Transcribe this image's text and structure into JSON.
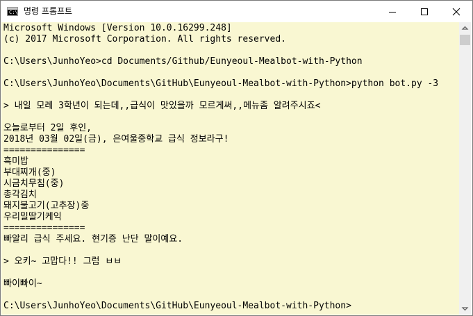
{
  "window": {
    "title": "명령 프롬프트",
    "icon": "cmd-icon",
    "icon_text": "C:\\"
  },
  "controls": {
    "minimize_icon": "minimize-icon",
    "maximize_icon": "maximize-icon",
    "close_icon": "close-icon"
  },
  "console": {
    "background": "#f9f7d2",
    "text_color": "#000000",
    "lines": [
      "Microsoft Windows [Version 10.0.16299.248]",
      "(c) 2017 Microsoft Corporation. All rights reserved.",
      "",
      "C:\\Users\\JunhoYeo>cd Documents/Github/Eunyeoul-Mealbot-with-Python",
      "",
      "C:\\Users\\JunhoYeo\\Documents\\GitHub\\Eunyeoul-Mealbot-with-Python>python bot.py -3",
      "",
      "> 내일 모레 3학년이 되는데,,급식이 맛있을까 모르게써,,메뉴좀 알려주시죠<",
      "",
      "오늘로부터 2일 후인,",
      "2018년 03월 02일(금), 은여울중학교 급식 정보라구!",
      "===============",
      "흑미밥",
      "부대찌개(중)",
      "시금치무침(중)",
      "총각김치",
      "돼지불고기(고추장)중",
      "우리밀딸기케익",
      "===============",
      "빠알리 급식 주세요. 현기증 난단 말이예요.",
      "",
      "> 오키~ 고맙다!! 그럼 ㅂㅂ",
      "",
      "빠이빠이~",
      "",
      "C:\\Users\\JunhoYeo\\Documents\\GitHub\\Eunyeoul-Mealbot-with-Python>"
    ]
  },
  "scrollbar": {
    "up_icon": "scroll-up-arrow-icon",
    "down_icon": "scroll-down-arrow-icon"
  }
}
